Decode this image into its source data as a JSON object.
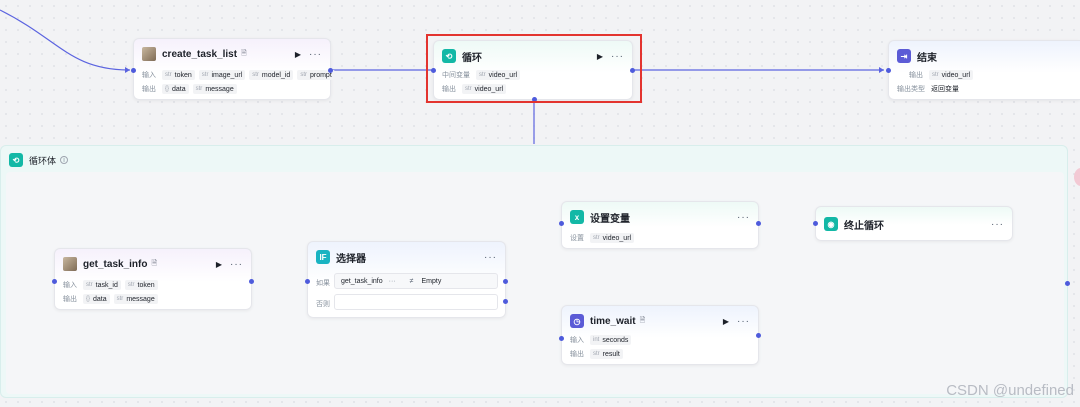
{
  "nodes": {
    "create_task_list": {
      "title": "create_task_list",
      "input_label": "输入",
      "inputs": [
        {
          "type": "str",
          "name": "token"
        },
        {
          "type": "str",
          "name": "image_url"
        },
        {
          "type": "str",
          "name": "model_id"
        },
        {
          "type": "str",
          "name": "prompt"
        }
      ],
      "output_label": "输出",
      "outputs": [
        {
          "type": "{}",
          "name": "data"
        },
        {
          "type": "str",
          "name": "message"
        }
      ]
    },
    "loop": {
      "title": "循环",
      "var_label": "中间变量",
      "var_type": "str",
      "var_name": "video_url",
      "output_label": "输出",
      "output_type": "str",
      "output_name": "video_url"
    },
    "end": {
      "title": "结束",
      "output_label": "输出",
      "output_type": "str",
      "output_name": "video_url",
      "output_kind_label": "输出类型",
      "output_kind_value": "返回变量"
    },
    "loop_body": {
      "title": "循环体"
    },
    "get_task_info": {
      "title": "get_task_info",
      "input_label": "输入",
      "inputs": [
        {
          "type": "str",
          "name": "task_id"
        },
        {
          "type": "str",
          "name": "token"
        }
      ],
      "output_label": "输出",
      "outputs": [
        {
          "type": "{}",
          "name": "data"
        },
        {
          "type": "str",
          "name": "message"
        }
      ]
    },
    "selector": {
      "title": "选择器",
      "if_label": "如果",
      "cond_left": "get_task_info",
      "cond_left_more": "···",
      "cond_op": "≠",
      "cond_right": "Empty",
      "else_label": "否则"
    },
    "set_var": {
      "title": "设置变量",
      "set_label": "设置",
      "set_type": "str",
      "set_name": "video_url"
    },
    "stop_loop": {
      "title": "终止循环"
    },
    "time_wait": {
      "title": "time_wait",
      "input_label": "输入",
      "input_type": "int",
      "input_name": "seconds",
      "output_label": "输出",
      "output_type": "str",
      "output_name": "result"
    }
  },
  "icons": {
    "run": "run-icon",
    "more": "more-icon",
    "doc": "doc-icon",
    "loop": "loop-icon",
    "end": "end-icon",
    "selector": "if-icon",
    "set_var": "variable-icon",
    "stop": "stop-icon",
    "wait": "clock-icon"
  },
  "colors": {
    "accent": "#4e5bdc",
    "loop_teal": "#13b8a6",
    "selection": "#e3342f"
  },
  "watermark": "CSDN @undefined"
}
